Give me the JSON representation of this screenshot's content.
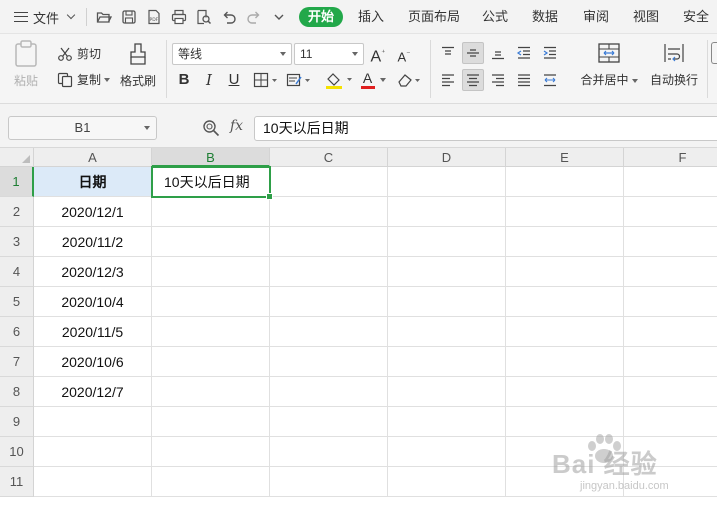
{
  "menubar": {
    "file_label": "文件",
    "tabs": [
      {
        "label": "开始",
        "active": true
      },
      {
        "label": "插入",
        "active": false
      },
      {
        "label": "页面布局",
        "active": false
      },
      {
        "label": "公式",
        "active": false
      },
      {
        "label": "数据",
        "active": false
      },
      {
        "label": "审阅",
        "active": false
      },
      {
        "label": "视图",
        "active": false
      },
      {
        "label": "安全",
        "active": false
      }
    ],
    "quick_access_icons": [
      "open-folder-icon",
      "save-icon",
      "export-pdf-icon",
      "print-icon",
      "print-preview-icon",
      "undo-icon",
      "redo-icon",
      "more-dropdown-icon"
    ],
    "pdf_icon_text": "PDF"
  },
  "ribbon": {
    "paste_label": "粘贴",
    "cut_label": "剪切",
    "copy_label": "复制",
    "format_painter_label": "格式刷",
    "font_name": "等线",
    "font_size": "11",
    "grow_font_symbol": "A",
    "shrink_font_symbol": "A",
    "bold_symbol": "B",
    "italic_symbol": "I",
    "underline_symbol": "U",
    "font_color_symbol": "A",
    "merge_center_label": "合并居中",
    "wrap_text_label": "自动换行",
    "colors": {
      "accent_green": "#22a84a",
      "font_color_bar": "#e02020",
      "fill_color_bar": "#f5e200"
    }
  },
  "formula_bar": {
    "name_box": "B1",
    "fx_label": "fx",
    "formula": "10天以后日期"
  },
  "sheet": {
    "columns": [
      "A",
      "B",
      "C",
      "D",
      "E",
      "F"
    ],
    "selected_column": "B",
    "rows": [
      "1",
      "2",
      "3",
      "4",
      "5",
      "6",
      "7",
      "8",
      "9",
      "10",
      "11"
    ],
    "selected_row": "1",
    "col_a": [
      "日期",
      "2020/12/1",
      "2020/11/2",
      "2020/12/3",
      "2020/10/4",
      "2020/11/5",
      "2020/10/6",
      "2020/12/7",
      "",
      "",
      ""
    ],
    "col_b": [
      "10天以后日期",
      "",
      "",
      "",
      "",
      "",
      "",
      "",
      "",
      "",
      ""
    ],
    "header_fill": "#dceaf8",
    "selection_color": "#2e9f48"
  },
  "watermark": {
    "brand": "Bai  经验",
    "url": "jingyan.baidu.com"
  }
}
